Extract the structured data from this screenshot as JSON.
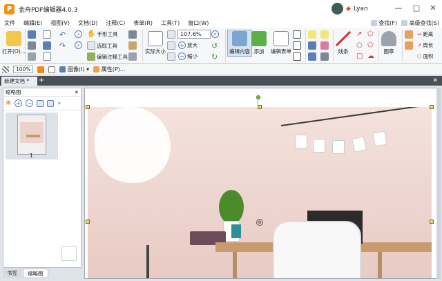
{
  "window": {
    "logo_letter": "P",
    "title": "金舟PDF编辑器4.0.3",
    "user_name": "Lyan",
    "controls": [
      "—",
      "□",
      "✕"
    ]
  },
  "menu": {
    "items": [
      "文件",
      "编辑(E)",
      "视图(V)",
      "文档(D)",
      "注释(C)",
      "表单(R)",
      "工具(T)",
      "窗口(W)"
    ],
    "find": "查找(F)",
    "advanced_find": "高级查找(S)"
  },
  "ribbon": {
    "open": "打开(O)...",
    "hand_tool": "手形工具",
    "select_text": "选取工具",
    "edit_annotation": "编辑注释工具",
    "zoom_value": "107.6%",
    "actual_size": "实际大小",
    "zoom_in": "放大",
    "zoom_out": "缩小",
    "edit_content": "编辑内容",
    "add": "添加",
    "edit_form": "编辑表单",
    "lines": "线条",
    "stamp": "图章",
    "distance": "距离",
    "perimeter": "周长",
    "area": "面积"
  },
  "toolbar2": {
    "zoom": "100%",
    "image": "图像(I)",
    "properties": "属性(P)..."
  },
  "tabs": {
    "active": "新建文档 *",
    "plus": "+",
    "close": "✕"
  },
  "side": {
    "title": "缩略图",
    "close": "✕",
    "page_number": "1",
    "tabs": [
      "书签",
      "缩略图"
    ]
  },
  "colors": {
    "accent": "#3a66aa",
    "logo": "#f29216",
    "tabbar": "#4b4f58",
    "wall": "#ecd2cc"
  }
}
